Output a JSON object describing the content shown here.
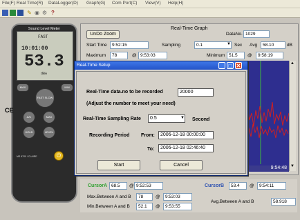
{
  "menu": [
    "File(F)",
    "Real Time(R)",
    "DataLogger(D)",
    "Graph(G)",
    "Com Port(C)",
    "View(V)",
    "Help(H)"
  ],
  "toolbar": {
    "icons": [
      "save-icon",
      "chart-icon",
      "table-icon",
      "pencil-icon",
      "record-icon",
      "settings-icon",
      "help-icon"
    ],
    "help_glyph": "?"
  },
  "meter": {
    "title": "Sound Level Meter",
    "mode": "FAST",
    "time": "10:01:00",
    "reading": "53.3",
    "unit": "dBA",
    "ce": "CE",
    "model": "MS 6700 / CLAIRE",
    "buttons": {
      "left": "MAX",
      "right": "MIN",
      "center": "FAST SLOW",
      "ac": "A/C",
      "max": "MAX MIN",
      "hold": "HOLD",
      "level": "LEVEL"
    }
  },
  "graph": {
    "title": "Real-Time Graph",
    "undo_zoom": "UnDo Zoom",
    "datano_label": "DataNo.",
    "datano_value": "1029",
    "start_time_label": "Start Time",
    "start_time_value": "9:52:15",
    "sampling_label": "Sampling",
    "sampling_value": "0.1",
    "sampling_unit": "Sec",
    "avg_label": "Avg",
    "avg_value": "58.10",
    "avg_unit": "dB",
    "maximum_label": "Maximum",
    "maximum_value": "78",
    "maximum_at": "@",
    "maximum_time": "9:53:03",
    "minimum_label": "Minimum",
    "minimum_value": "51.5",
    "minimum_at": "@",
    "minimum_time": "9:58:19",
    "time_readout": "9:54:48",
    "colors": {
      "chart_bg": "#2e2e8f",
      "trace": "#d12020",
      "cursor_line": "#3dbb3d"
    }
  },
  "dialog": {
    "title": "Real-Time Setup",
    "datano_label": "Real-Time data.no to be recorded",
    "datano_value": "20000",
    "adjust_note": "(Adjust the number to meet your need)",
    "sampling_label": "Real-Time Sampling Rate",
    "sampling_value": "0.5",
    "sampling_unit": "Second",
    "period_label": "Recording Period",
    "from_label": "From:",
    "from_value": "2006-12-18 00:00:00",
    "to_label": "To:",
    "to_value": "2006-12-18 02:46:40",
    "start_button": "Start",
    "cancel_button": "Cancel"
  },
  "cursors": {
    "a_label": "CursorA",
    "a_value": "68.5",
    "a_at": "@",
    "a_time": "9:52:53",
    "b_label": "CursorB",
    "b_value": "53.4",
    "b_at": "@",
    "b_time": "9:54:11",
    "max_label": "Max.Between A and B",
    "max_value": "78",
    "max_at": "@",
    "max_time": "9:53:03",
    "min_label": "Min.Between A and B",
    "min_value": "52.1",
    "min_at": "@",
    "min_time": "9:53:55",
    "avg_label": "Avg.Between A and B",
    "avg_value": "58.918"
  }
}
